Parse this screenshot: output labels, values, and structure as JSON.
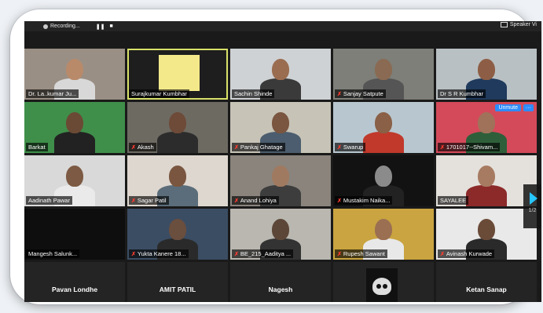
{
  "topbar": {
    "recording_label": "Recording...",
    "pause_label": "❚❚",
    "stop_label": "■",
    "speaker_view_label": "Speaker Vi"
  },
  "participants": [
    {
      "name": "Dr. La..kumar Ju...",
      "muted": false,
      "bg": "#9a8f84",
      "skin": "#b88a6a",
      "shirt": "#d8d8d8"
    },
    {
      "name": "Surajkumar Kumbhar",
      "muted": false,
      "bg": "#1e1e1e",
      "video": "yellow",
      "active": true
    },
    {
      "name": "Sachin Shinde",
      "muted": false,
      "bg": "#cfd2d4",
      "skin": "#9a6d50",
      "shirt": "#3a3a3a"
    },
    {
      "name": "Sanjay Satpute",
      "muted": true,
      "bg": "#7d7f78",
      "skin": "#8a6a52",
      "shirt": "#555"
    },
    {
      "name": "Dr S R Kumbhar",
      "muted": false,
      "bg": "#b9c0c3",
      "skin": "#8d5e45",
      "shirt": "#1f3a5c"
    },
    {
      "name": "Barkat",
      "muted": false,
      "bg": "#3f8f4a",
      "skin": "#6b4a35",
      "shirt": "#222"
    },
    {
      "name": "Akash",
      "muted": true,
      "bg": "#6d6a62",
      "skin": "#6d4b38",
      "shirt": "#2c2c2c"
    },
    {
      "name": "Pankaj Ghatage",
      "muted": true,
      "bg": "#c7c3b7",
      "skin": "#7a5540",
      "shirt": "#4b5d6e"
    },
    {
      "name": "Swarup",
      "muted": true,
      "bg": "#b8c7cf",
      "skin": "#8a6046",
      "shirt": "#c0392b"
    },
    {
      "name": "1701017--Shivam...",
      "muted": true,
      "bg": "#d44a5a",
      "skin": "#a0725a",
      "shirt": "#2e5f3a",
      "unmute_label": "Unmute",
      "more_label": "···"
    },
    {
      "name": "Aadinath Pawar",
      "muted": false,
      "bg": "#d9d9d9",
      "skin": "#7d5a43",
      "shirt": "#eaeaea"
    },
    {
      "name": "Sagar Patil",
      "muted": true,
      "bg": "#ded7cf",
      "skin": "#7a5640",
      "shirt": "#5b6d7a"
    },
    {
      "name": "Anand Lohiya",
      "muted": true,
      "bg": "#8a847d",
      "skin": "#a07a60",
      "shirt": "#3d3d3d"
    },
    {
      "name": "Mustakim Naika...",
      "muted": true,
      "bg": "#121212",
      "skin": "#8b8b8b",
      "shirt": "#222"
    },
    {
      "name": "SAYALEE",
      "muted": false,
      "bg": "#e4e1dc",
      "skin": "#a77b62",
      "shirt": "#8c2a2a"
    },
    {
      "name": "Mangesh Salunk...",
      "muted": false,
      "bg": "#0e0e0e",
      "video": "none"
    },
    {
      "name": "Yukta Kanere 18...",
      "muted": true,
      "bg": "#3b4d63",
      "skin": "#6a4e3e",
      "shirt": "#2a2a2a"
    },
    {
      "name": "BE_215_Aaditya ...",
      "muted": true,
      "bg": "#b9b7b0",
      "skin": "#5c4638",
      "shirt": "#333"
    },
    {
      "name": "Rupesh Sawant",
      "muted": true,
      "bg": "#c9a440",
      "skin": "#9b6f52",
      "shirt": "#e8e8e8"
    },
    {
      "name": "Avinash Kurwade",
      "muted": true,
      "bg": "#e9e9e9",
      "skin": "#6a4b38",
      "shirt": "#2a2a2a"
    },
    {
      "name": "Pavan Londhe",
      "muted": false,
      "video": "label"
    },
    {
      "name": "AMIT PATIL",
      "muted": false,
      "video": "label"
    },
    {
      "name": "Nagesh",
      "muted": false,
      "video": "label"
    },
    {
      "name": "",
      "muted": false,
      "video": "skull"
    },
    {
      "name": "Ketan Sanap",
      "muted": false,
      "video": "label"
    }
  ],
  "pager": {
    "page_label": "1/2"
  },
  "colors": {
    "muted_mic": "#ff3b30",
    "active_border": "#d9e26a",
    "accent": "#2d8cff"
  },
  "icons": {
    "muted": "mic-muted-icon",
    "next": "next-page-arrow-icon"
  }
}
